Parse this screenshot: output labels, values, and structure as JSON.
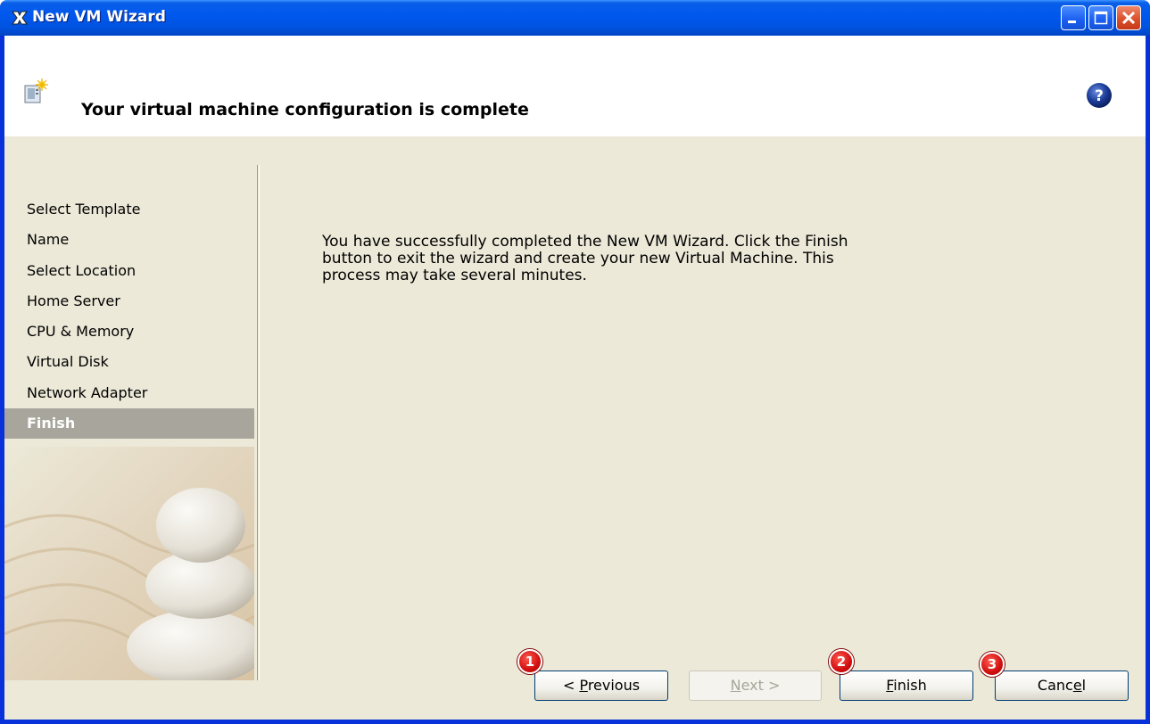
{
  "window": {
    "title": "New VM Wizard"
  },
  "header": {
    "title": "Your virtual machine configuration is complete"
  },
  "steps": [
    {
      "label": "Select Template",
      "active": false
    },
    {
      "label": "Name",
      "active": false
    },
    {
      "label": "Select Location",
      "active": false
    },
    {
      "label": "Home Server",
      "active": false
    },
    {
      "label": "CPU & Memory",
      "active": false
    },
    {
      "label": "Virtual Disk",
      "active": false
    },
    {
      "label": "Network Adapter",
      "active": false
    },
    {
      "label": "Finish",
      "active": true
    }
  ],
  "content": {
    "line1": "You have successfully completed the New VM Wizard. Click the Finish",
    "line2": "button to exit the wizard and create your new Virtual Machine. This",
    "line3": "process may take several minutes."
  },
  "buttons": {
    "previous": {
      "pre": "< ",
      "accel": "P",
      "post": "revious",
      "enabled": true
    },
    "next": {
      "pre": "",
      "accel": "N",
      "post": "ext >",
      "enabled": false
    },
    "finish": {
      "pre": "",
      "accel": "F",
      "post": "inish",
      "enabled": true
    },
    "cancel": {
      "pre": "Canc",
      "accel": "e",
      "post": "l",
      "enabled": true
    }
  },
  "badges": [
    "1",
    "2",
    "3"
  ],
  "colors": {
    "titlebar": "#0058ee",
    "client_bg": "#ece9d8",
    "active_step_bg": "#a8a69c",
    "badge": "#d10f0f"
  },
  "icons": [
    "xen-app-icon",
    "minimize-icon",
    "maximize-icon",
    "close-icon",
    "new-vm-icon",
    "help-icon",
    "stones-image"
  ]
}
